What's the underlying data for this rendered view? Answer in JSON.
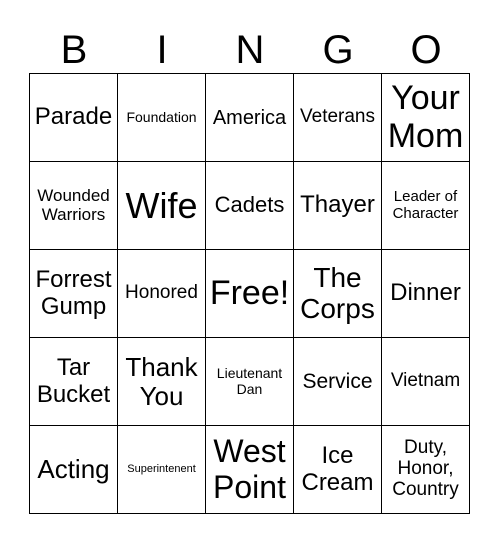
{
  "header": [
    "B",
    "I",
    "N",
    "G",
    "O"
  ],
  "rows": [
    [
      [
        "Parade",
        24
      ],
      [
        "Foundation",
        14
      ],
      [
        "America",
        20
      ],
      [
        "Veterans",
        19
      ],
      [
        "Your Mom",
        34
      ]
    ],
    [
      [
        "Wounded Warriors",
        17
      ],
      [
        "Wife",
        36
      ],
      [
        "Cadets",
        22
      ],
      [
        "Thayer",
        24
      ],
      [
        "Leader of Character",
        15
      ]
    ],
    [
      [
        "Forrest Gump",
        24
      ],
      [
        "Honored",
        19
      ],
      [
        "Free!",
        34
      ],
      [
        "The Corps",
        28
      ],
      [
        "Dinner",
        24
      ]
    ],
    [
      [
        "Tar Bucket",
        24
      ],
      [
        "Thank You",
        26
      ],
      [
        "Lieutenant Dan",
        14
      ],
      [
        "Service",
        21
      ],
      [
        "Vietnam",
        19
      ]
    ],
    [
      [
        "Acting",
        26
      ],
      [
        "Superintenent",
        11
      ],
      [
        "West Point",
        32
      ],
      [
        "Ice Cream",
        24
      ],
      [
        "Duty, Honor, Country",
        19
      ]
    ]
  ]
}
